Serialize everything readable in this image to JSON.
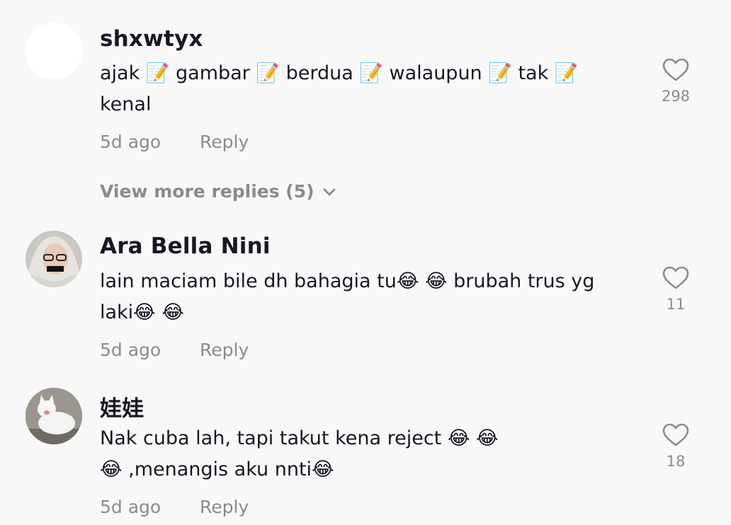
{
  "comments": [
    {
      "username": "shxwtyx",
      "text_line1": "ajak 📝 gambar 📝 berdua 📝 walaupun 📝 tak 📝",
      "text_line2": "kenal",
      "time": "5d ago",
      "reply_label": "Reply",
      "likes": "298"
    },
    {
      "username": "Ara Bella Nini",
      "text_line1": "lain maciam bile dh bahagia tu😂 😂 brubah trus yg",
      "text_line2": "laki😂 😂",
      "time": "5d ago",
      "reply_label": "Reply",
      "likes": "11"
    },
    {
      "username": "娃娃",
      "text_line1": "Nak cuba lah, tapi takut kena reject 😂 😂",
      "text_line2": "😂 ,menangis aku nnti😂",
      "time": "5d ago",
      "reply_label": "Reply",
      "likes": "18"
    }
  ],
  "view_more_replies": "View more replies (5)",
  "icons": {
    "like": "heart-outline-icon",
    "expand": "chevron-down-icon"
  }
}
